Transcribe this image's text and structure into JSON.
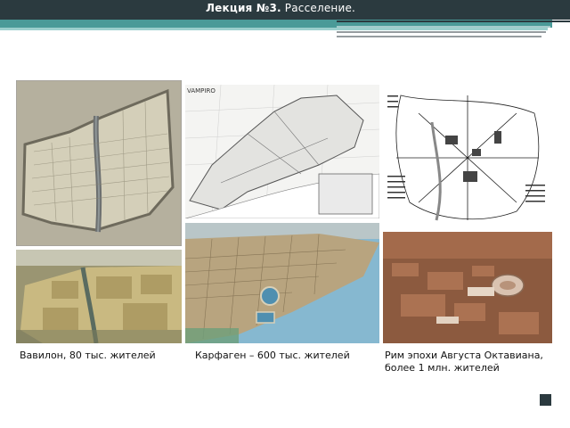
{
  "header": {
    "title_bold": "Лекция №3.",
    "title_rest": " Расселение."
  },
  "panels": [
    {
      "name": "babylon-map-image",
      "desc": "Babylon plan"
    },
    {
      "name": "carthage-map-image"
    },
    {
      "name": "rome-map-image"
    },
    {
      "name": "babylon-aerial-image"
    },
    {
      "name": "carthage-aerial-image"
    },
    {
      "name": "rome-model-image"
    }
  ],
  "map_watermark": "VAMPIRO",
  "captions": {
    "babylon": "Вавилон, 80 тыс. жителей",
    "carthage": "Карфаген – 600 тыс. жителей",
    "rome_line1": "Рим эпохи Августа Октавиана,",
    "rome_line2": "более 1 млн. жителей"
  },
  "colors": {
    "header_bg": "#2b3a3f",
    "teal": "#4a9a98",
    "teal_light": "#9ccfcd"
  }
}
